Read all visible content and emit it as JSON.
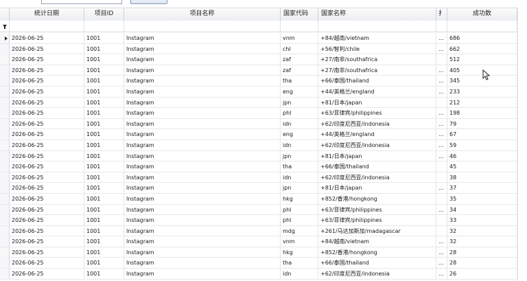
{
  "columns": {
    "indicator": "",
    "date": "统计日期",
    "project_id": "项目ID",
    "project_name": "项目名称",
    "country_code": "国家代码",
    "country_name": "国家名称",
    "extra": "扌",
    "success_count": "成功数"
  },
  "rows": [
    {
      "date": "2026-06-25",
      "project_id": "1001",
      "project_name": "Instagram",
      "country_code": "vnm",
      "country_name": "+84/越南/vietnam",
      "extra": "...",
      "success_count": "686",
      "selected": true
    },
    {
      "date": "2026-06-25",
      "project_id": "1001",
      "project_name": "Instagram",
      "country_code": "chl",
      "country_name": "+56/智利/chile",
      "extra": "...",
      "success_count": "662"
    },
    {
      "date": "2026-06-25",
      "project_id": "1001",
      "project_name": "Instagram",
      "country_code": "zaf",
      "country_name": "+27/南非/southafrica",
      "extra": "",
      "success_count": "512"
    },
    {
      "date": "2026-06-25",
      "project_id": "1001",
      "project_name": "Instagram",
      "country_code": "zaf",
      "country_name": "+27/南非/southafrica",
      "extra": "...",
      "success_count": "405"
    },
    {
      "date": "2026-06-25",
      "project_id": "1001",
      "project_name": "Instagram",
      "country_code": "tha",
      "country_name": "+66/泰国/thailand",
      "extra": "...",
      "success_count": "345"
    },
    {
      "date": "2026-06-25",
      "project_id": "1001",
      "project_name": "Instagram",
      "country_code": "eng",
      "country_name": "+44/英格兰/england",
      "extra": "...",
      "success_count": "233"
    },
    {
      "date": "2026-06-25",
      "project_id": "1001",
      "project_name": "Instagram",
      "country_code": "jpn",
      "country_name": "+81/日本/japan",
      "extra": "",
      "success_count": "212"
    },
    {
      "date": "2026-06-25",
      "project_id": "1001",
      "project_name": "Instagram",
      "country_code": "phl",
      "country_name": "+63/菲律宾/philippines",
      "extra": "...",
      "success_count": "198"
    },
    {
      "date": "2026-06-25",
      "project_id": "1001",
      "project_name": "Instagram",
      "country_code": "idn",
      "country_name": "+62/印度尼西亚/indonesia",
      "extra": "...",
      "success_count": "79"
    },
    {
      "date": "2026-06-25",
      "project_id": "1001",
      "project_name": "Instagram",
      "country_code": "eng",
      "country_name": "+44/英格兰/england",
      "extra": "...",
      "success_count": "67"
    },
    {
      "date": "2026-06-25",
      "project_id": "1001",
      "project_name": "Instagram",
      "country_code": "idn",
      "country_name": "+62/印度尼西亚/indonesia",
      "extra": "...",
      "success_count": "59"
    },
    {
      "date": "2026-06-25",
      "project_id": "1001",
      "project_name": "Instagram",
      "country_code": "jpn",
      "country_name": "+81/日本/japan",
      "extra": "...",
      "success_count": "46"
    },
    {
      "date": "2026-06-25",
      "project_id": "1001",
      "project_name": "Instagram",
      "country_code": "tha",
      "country_name": "+66/泰国/thailand",
      "extra": "",
      "success_count": "45"
    },
    {
      "date": "2026-06-25",
      "project_id": "1001",
      "project_name": "Instagram",
      "country_code": "idn",
      "country_name": "+62/印度尼西亚/indonesia",
      "extra": "",
      "success_count": "38"
    },
    {
      "date": "2026-06-25",
      "project_id": "1001",
      "project_name": "Instagram",
      "country_code": "jpn",
      "country_name": "+81/日本/japan",
      "extra": "...",
      "success_count": "37"
    },
    {
      "date": "2026-06-25",
      "project_id": "1001",
      "project_name": "Instagram",
      "country_code": "hkg",
      "country_name": "+852/香港/hongkong",
      "extra": "",
      "success_count": "35"
    },
    {
      "date": "2026-06-25",
      "project_id": "1001",
      "project_name": "Instagram",
      "country_code": "phl",
      "country_name": "+63/菲律宾/philippines",
      "extra": "...",
      "success_count": "34"
    },
    {
      "date": "2026-06-25",
      "project_id": "1001",
      "project_name": "Instagram",
      "country_code": "phl",
      "country_name": "+63/菲律宾/philippines",
      "extra": "",
      "success_count": "33"
    },
    {
      "date": "2026-06-25",
      "project_id": "1001",
      "project_name": "Instagram",
      "country_code": "mdg",
      "country_name": "+261/马达加斯加/madagascar",
      "extra": "",
      "success_count": "32"
    },
    {
      "date": "2026-06-25",
      "project_id": "1001",
      "project_name": "Instagram",
      "country_code": "vnm",
      "country_name": "+84/越南/vietnam",
      "extra": "...",
      "success_count": "32"
    },
    {
      "date": "2026-06-25",
      "project_id": "1001",
      "project_name": "Instagram",
      "country_code": "hkg",
      "country_name": "+852/香港/hongkong",
      "extra": "...",
      "success_count": "28"
    },
    {
      "date": "2026-06-25",
      "project_id": "1001",
      "project_name": "Instagram",
      "country_code": "tha",
      "country_name": "+66/泰国/thailand",
      "extra": "...",
      "success_count": "28"
    },
    {
      "date": "2026-06-25",
      "project_id": "1001",
      "project_name": "Instagram",
      "country_code": "idn",
      "country_name": "+62/印度尼西亚/indonesia",
      "extra": "...",
      "success_count": "26"
    }
  ]
}
